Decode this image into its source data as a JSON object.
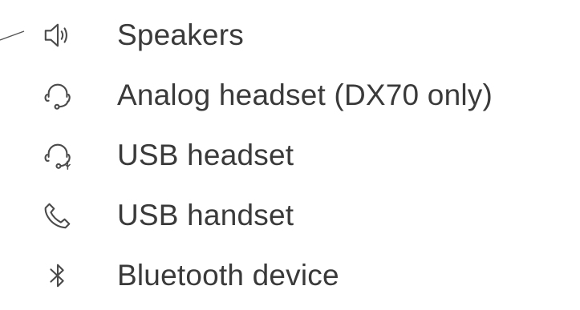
{
  "devices": [
    {
      "label": "Speakers",
      "icon": "speaker-icon"
    },
    {
      "label": "Analog headset (DX70 only)",
      "icon": "headset-icon"
    },
    {
      "label": "USB headset",
      "icon": "usb-headset-icon"
    },
    {
      "label": "USB handset",
      "icon": "handset-icon"
    },
    {
      "label": "Bluetooth device",
      "icon": "bluetooth-icon"
    }
  ],
  "colors": {
    "text": "#3a3a3a",
    "icon": "#4a4a4a"
  }
}
